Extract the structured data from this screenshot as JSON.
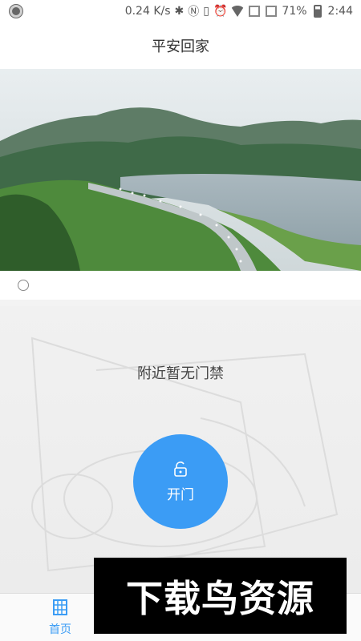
{
  "status_bar": {
    "network_speed": "0.24 K/s",
    "battery": "71%",
    "time": "2:44"
  },
  "header": {
    "title": "平安回家"
  },
  "banner": {
    "indicator_count": 1
  },
  "main": {
    "empty_message": "附近暂无门禁",
    "open_button_label": "开门"
  },
  "bottom_nav": {
    "home_label": "首页"
  },
  "watermark": {
    "text": "下载鸟资源"
  },
  "colors": {
    "accent": "#3b9cf5",
    "header_bg": "#ffffff",
    "page_bg": "#f1f1f1"
  }
}
